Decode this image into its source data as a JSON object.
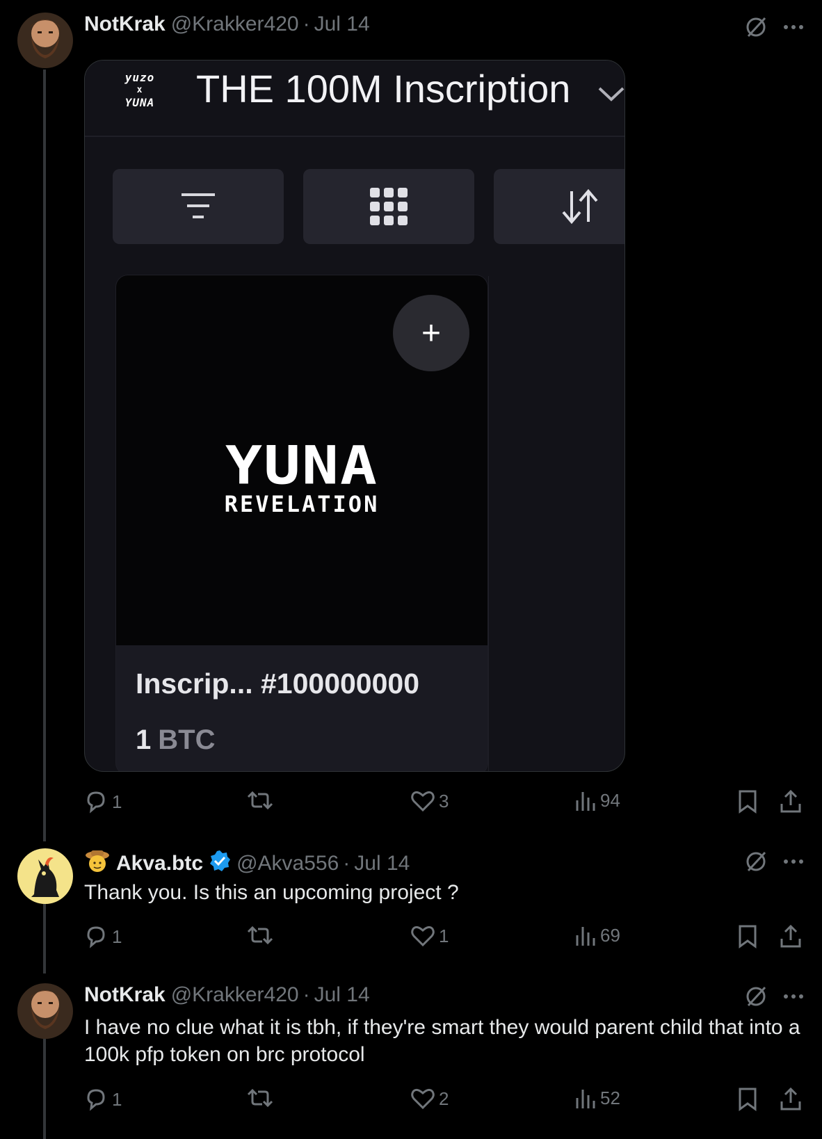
{
  "tweets": [
    {
      "name": "NotKrak",
      "handle": "@Krakker420",
      "separator": "·",
      "date": "Jul 14",
      "text": "",
      "stats": {
        "replies": "1",
        "reposts": "",
        "likes": "3",
        "views": "94"
      }
    },
    {
      "name": "Akva.btc",
      "handle": "@Akva556",
      "separator": "·",
      "date": "Jul 14",
      "text": "Thank you. Is this an upcoming project ?",
      "stats": {
        "replies": "1",
        "reposts": "",
        "likes": "1",
        "views": "69"
      }
    },
    {
      "name": "NotKrak",
      "handle": "@Krakker420",
      "separator": "·",
      "date": "Jul 14",
      "text": "I have no clue what it is tbh, if they're smart they would parent child that into a 100k pfp token on brc protocol",
      "stats": {
        "replies": "1",
        "reposts": "",
        "likes": "2",
        "views": "52"
      }
    }
  ],
  "media": {
    "logo_top": "yuzo",
    "logo_x": "x",
    "logo_bottom": "YUNA",
    "title": "THE 100M Inscription",
    "card": {
      "plus": "+",
      "art_big": "YUNA",
      "art_small": "REVELATION",
      "title": "Inscrip... #100000000",
      "price_value": "1",
      "price_unit": "BTC"
    }
  },
  "colors": {
    "background": "#000000",
    "muted": "#71767b",
    "text": "#e7e9ea",
    "verified": "#1d9bf0"
  }
}
